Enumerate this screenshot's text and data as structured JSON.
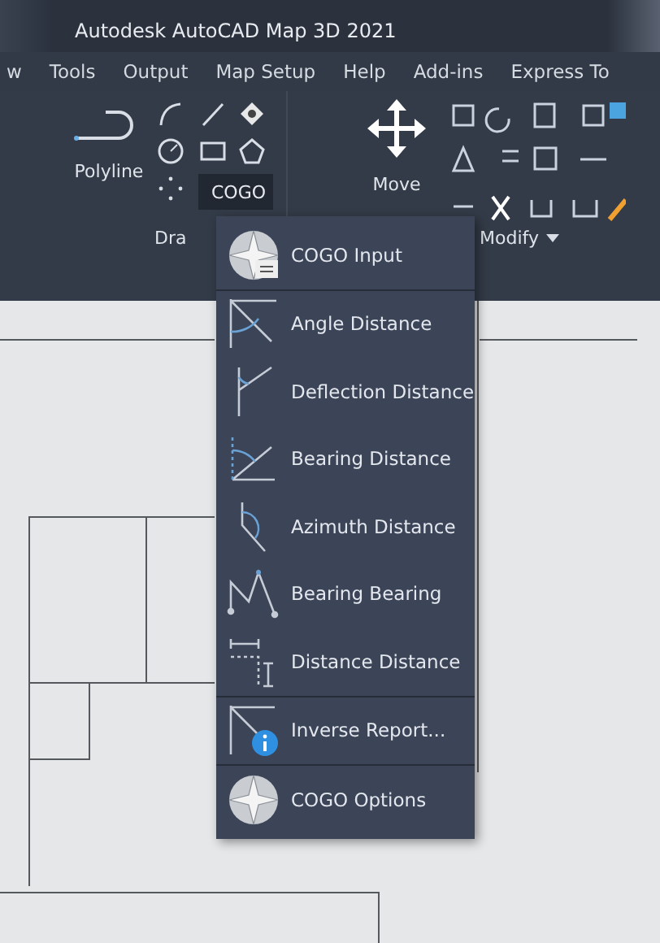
{
  "window": {
    "title": "Autodesk AutoCAD Map 3D 2021"
  },
  "ribbon_tabs": [
    "w",
    "Tools",
    "Output",
    "Map Setup",
    "Help",
    "Add-ins",
    "Express To"
  ],
  "draw_panel": {
    "polyline_label": "Polyline",
    "cogo_label": "COGO",
    "panel_label": "Dra"
  },
  "modify_panel": {
    "move_label": "Move",
    "panel_label": "Modify"
  },
  "menu": {
    "items": [
      {
        "label": "COGO Input",
        "kind": "input",
        "separator_below": true
      },
      {
        "label": "Angle Distance",
        "kind": "angle",
        "separator_below": false
      },
      {
        "label": "Deflection Distance",
        "kind": "deflection",
        "separator_below": false
      },
      {
        "label": "Bearing Distance",
        "kind": "bearing",
        "separator_below": false
      },
      {
        "label": "Azimuth Distance",
        "kind": "azimuth",
        "separator_below": false
      },
      {
        "label": "Bearing Bearing",
        "kind": "bearingbearing",
        "separator_below": false
      },
      {
        "label": "Distance Distance",
        "kind": "distancedistance",
        "separator_below": true
      },
      {
        "label": "Inverse Report...",
        "kind": "inverse",
        "separator_below": true
      },
      {
        "label": "COGO Options",
        "kind": "options",
        "separator_below": false
      }
    ]
  }
}
